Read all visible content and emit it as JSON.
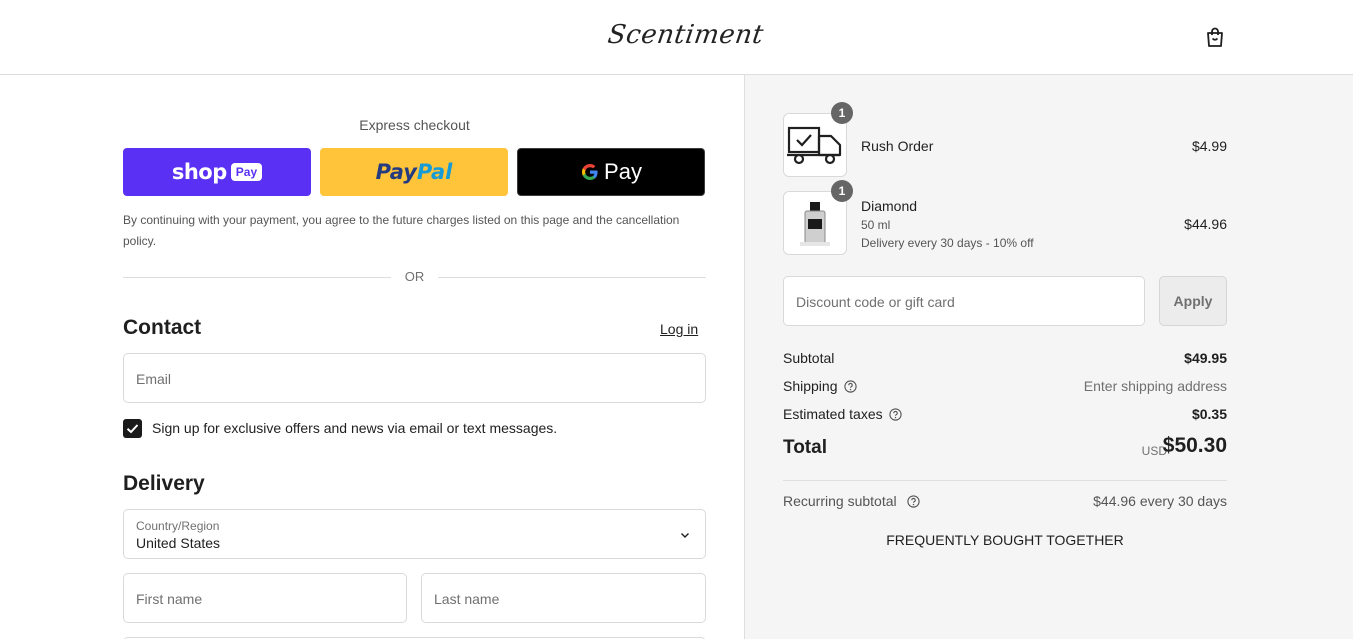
{
  "header": {
    "logo_text": "Scentiment",
    "cart_icon": "shopping-bag-icon"
  },
  "express": {
    "title": "Express checkout",
    "shop_pay": {
      "word": "shop",
      "pill": "Pay"
    },
    "paypal": {
      "part1": "Pay",
      "part2": "Pal"
    },
    "google_pay": {
      "g": "G",
      "word": "Pay"
    },
    "disclaimer": "By continuing with your payment, you agree to the future charges listed on this page and the cancellation policy.",
    "or_label": "OR"
  },
  "contact": {
    "heading": "Contact",
    "login_link": "Log in",
    "email_placeholder": "Email",
    "marketing_checked": true,
    "marketing_label": "Sign up for exclusive offers and news via email or text messages."
  },
  "delivery": {
    "heading": "Delivery",
    "country_label": "Country/Region",
    "country_value": "United States",
    "first_name_placeholder": "First name",
    "last_name_placeholder": "Last name"
  },
  "order": {
    "items": [
      {
        "quantity": "1",
        "name": "Rush Order",
        "price": "$4.99",
        "icon": "delivery-truck-icon"
      },
      {
        "quantity": "1",
        "name": "Diamond",
        "size": "50 ml",
        "plan": "Delivery every 30 days - 10% off",
        "price": "$44.96",
        "icon": "perfume-bottle-icon"
      }
    ],
    "discount_placeholder": "Discount code or gift card",
    "apply_label": "Apply",
    "subtotal_label": "Subtotal",
    "subtotal_value": "$49.95",
    "shipping_label": "Shipping",
    "shipping_value": "Enter shipping address",
    "taxes_label": "Estimated taxes",
    "taxes_value": "$0.35",
    "total_label": "Total",
    "currency": "USD",
    "total_value": "$50.30",
    "recurring_label": "Recurring subtotal",
    "recurring_value": "$44.96 every 30 days",
    "fbt_heading": "FREQUENTLY BOUGHT TOGETHER"
  },
  "colors": {
    "shop_pay": "#5a31f4",
    "paypal": "#ffc439",
    "google_pay": "#000000",
    "summary_bg": "#f5f5f5"
  }
}
